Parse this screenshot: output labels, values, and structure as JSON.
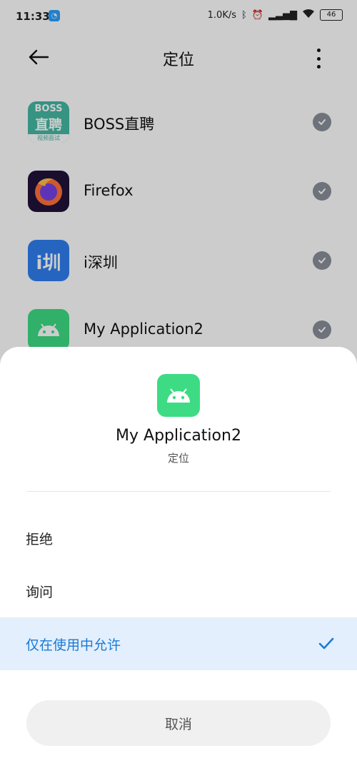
{
  "status_bar": {
    "time": "11:33",
    "network_speed": "1.0K/s",
    "battery": "46"
  },
  "app_bar": {
    "title": "定位"
  },
  "apps": [
    {
      "name": "BOSS直聘",
      "icon_text_top": "BOSS",
      "icon_text_mid": "直聘",
      "icon_text_bottom": "视频面试"
    },
    {
      "name": "Firefox"
    },
    {
      "name": "i深圳",
      "icon_text": "i圳"
    },
    {
      "name": "My Application2"
    }
  ],
  "sheet": {
    "app_name": "My Application2",
    "permission": "定位",
    "options": [
      {
        "label": "拒绝"
      },
      {
        "label": "询问"
      },
      {
        "label": "仅在使用中允许"
      }
    ],
    "selected_index": 2,
    "cancel_label": "取消"
  },
  "colors": {
    "selected_bg": "#e3effc",
    "selected_text": "#1a7ad6",
    "boss_green": "#45b8a3",
    "android_green": "#3ddc84"
  }
}
